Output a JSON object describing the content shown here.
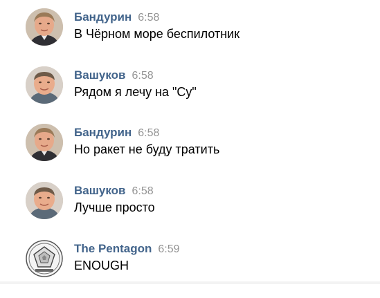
{
  "messages": [
    {
      "author": "Бандурин",
      "time": "6:58",
      "text": "В Чёрном море беспилотник",
      "avatar_icon": "user-photo-icon"
    },
    {
      "author": "Вашуков",
      "time": "6:58",
      "text": "Рядом я лечу на \"Су\"",
      "avatar_icon": "user-photo-icon"
    },
    {
      "author": "Бандурин",
      "time": "6:58",
      "text": "Но ракет не буду тратить",
      "avatar_icon": "user-photo-icon"
    },
    {
      "author": "Вашуков",
      "time": "6:58",
      "text": "Лучше просто",
      "avatar_icon": "user-photo-icon"
    },
    {
      "author": "The Pentagon",
      "time": "6:59",
      "text": "ENOUGH",
      "avatar_icon": "pentagon-seal-icon"
    }
  ],
  "colors": {
    "author": "#42648b",
    "time": "#939393",
    "text": "#000000"
  }
}
